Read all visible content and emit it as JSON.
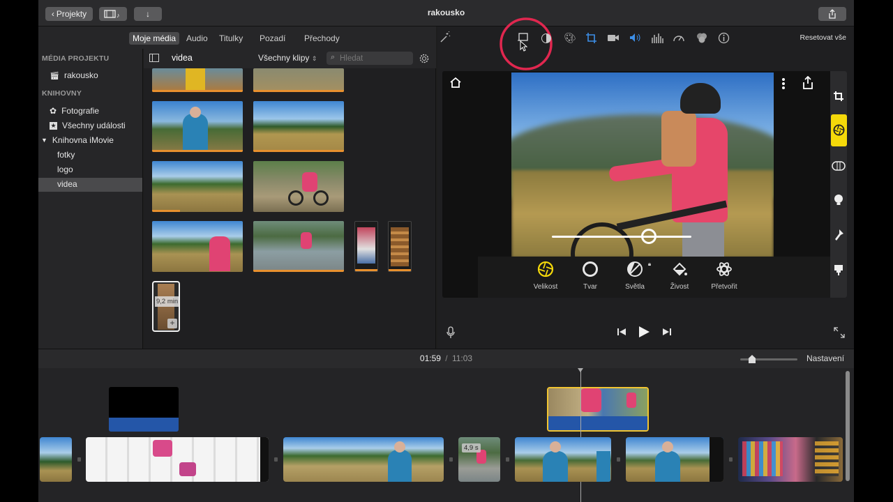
{
  "window": {
    "title": "rakousko",
    "back_label": "Projekty"
  },
  "browser_tabs": [
    "Moje média",
    "Audio",
    "Titulky",
    "Pozadí",
    "Přechody"
  ],
  "sidebar": {
    "project_media_header": "MÉDIA PROJEKTU",
    "project_item": "rakousko",
    "libraries_header": "KNIHOVNY",
    "items": [
      {
        "label": "Fotografie",
        "icon": "flower-icon"
      },
      {
        "label": "Všechny události",
        "icon": "star-icon"
      }
    ],
    "library": {
      "label": "Knihovna iMovie",
      "children": [
        "fotky",
        "logo",
        "videa"
      ]
    },
    "selected": "videa"
  },
  "browser": {
    "folder": "videa",
    "filter_label": "Všechny klipy",
    "search_placeholder": "Hledat",
    "duration_badge": "9,2 min"
  },
  "viewer": {
    "reset_label": "Resetovat vše",
    "tools": [
      "Velikost",
      "Tvar",
      "Světla",
      "Živost",
      "Přetvořit"
    ],
    "active_tool": "Velikost",
    "slider_value": 0.7
  },
  "timeline": {
    "current_time": "01:59",
    "separator": "/",
    "total_time": "11:03",
    "settings_label": "Nastavení",
    "clip_badge": "4,9 s"
  },
  "colors": {
    "accent_yellow": "#f5d90a",
    "highlight_red": "#e0274f",
    "audio_blue": "#2456a8",
    "media_orange": "#e8902e"
  }
}
